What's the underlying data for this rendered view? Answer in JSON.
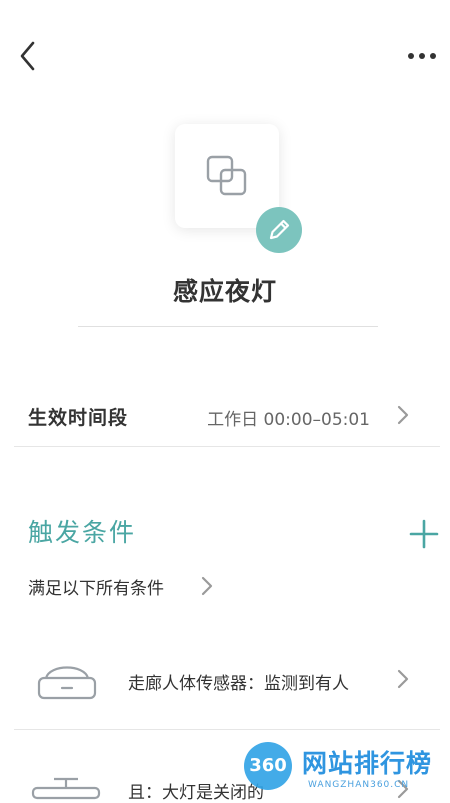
{
  "scene": {
    "name": "感应夜灯"
  },
  "effective_time": {
    "label": "生效时间段",
    "value": "工作日 00:00–05:01"
  },
  "triggers": {
    "title": "触发条件",
    "mode_label": "满足以下所有条件",
    "conditions": [
      {
        "text": "走廊人体传感器：监测到有人",
        "icon": "sensor-icon"
      },
      {
        "text": "且：大灯是关闭的",
        "icon": "ceiling-light-icon"
      }
    ]
  },
  "watermark": {
    "logo": "360",
    "title": "网站排行榜",
    "subtitle": "WANGZHAN360.CN"
  },
  "colors": {
    "accent": "#4aa6a3",
    "badge": "#7cc4be",
    "chevron": "#9a9a9a",
    "icon_stroke": "#9aa0a6"
  }
}
